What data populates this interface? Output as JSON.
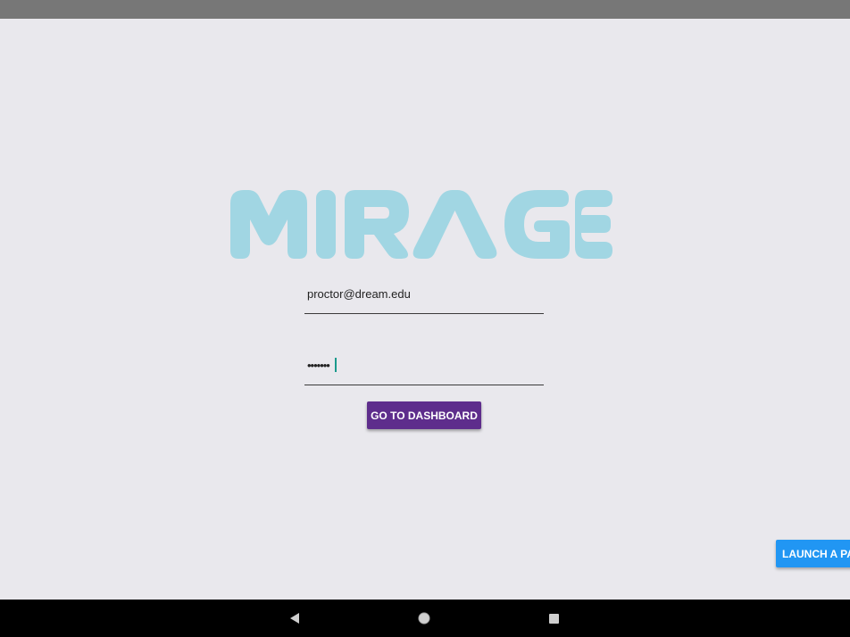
{
  "logo": {
    "text": "MIRAGE",
    "color": "#a1d6e3"
  },
  "login": {
    "email_value": "proctor@dream.edu",
    "email_placeholder": "",
    "password_value": "•••••••",
    "submit_label": "GO TO DASHBOARD"
  },
  "launch_button": {
    "label": "LAUNCH A PA"
  },
  "navigation": {
    "back_icon": "back-triangle-icon",
    "home_icon": "home-circle-icon",
    "recents_icon": "recents-square-icon"
  },
  "colors": {
    "background": "#e9e8ed",
    "status_bar": "#777777",
    "primary_button": "#5e2d8c",
    "launch_button": "#2196f3",
    "nav_bar": "#000000"
  }
}
